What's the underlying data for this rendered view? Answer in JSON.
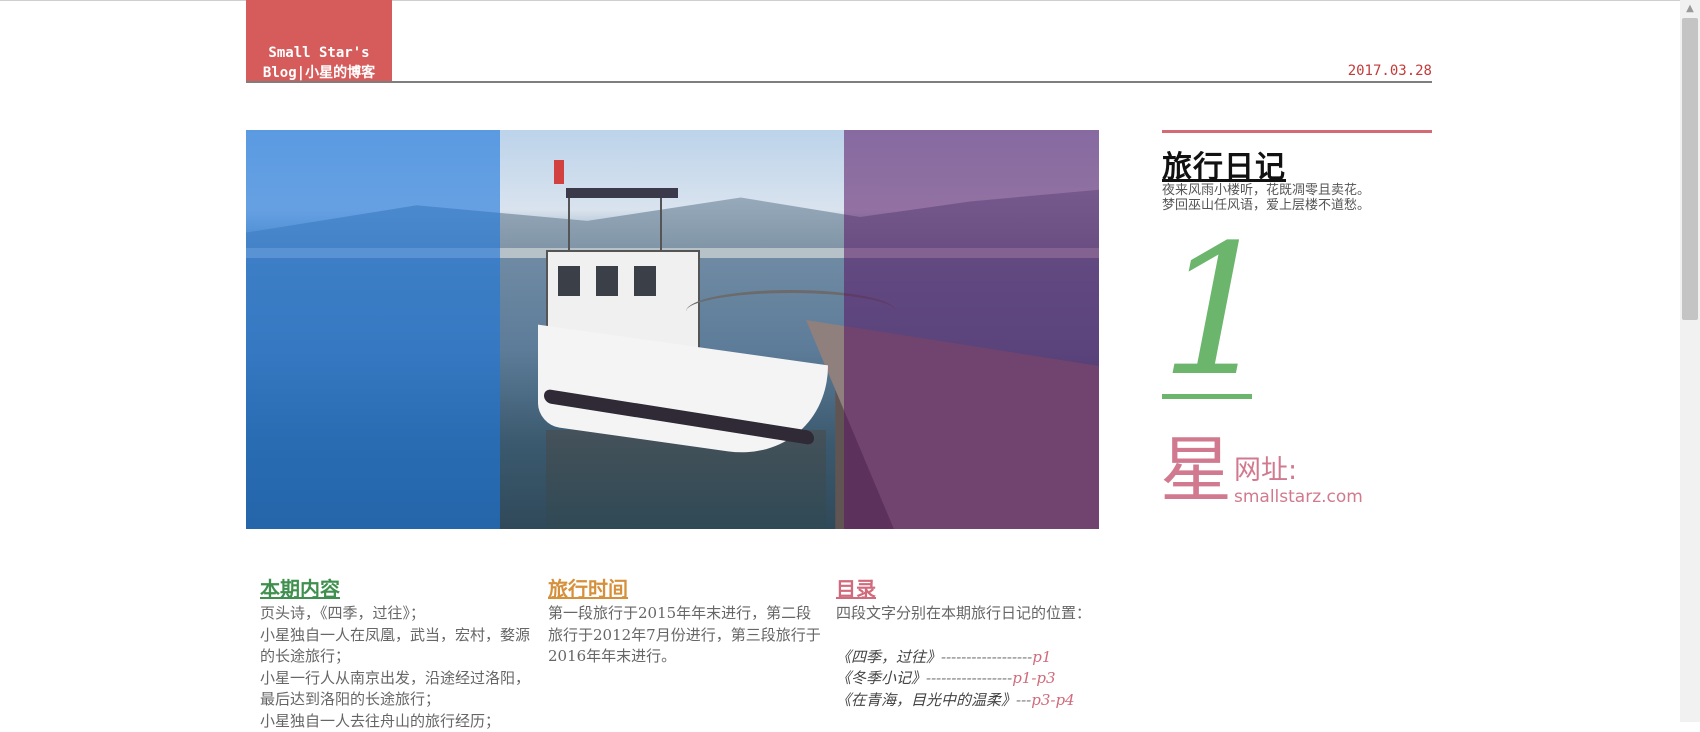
{
  "header": {
    "logo_line1": "Small Star's",
    "logo_line2": "Blog|小星的博客",
    "date": "2017.03.28"
  },
  "sidebar": {
    "title": "旅行日记",
    "poem_line1": "夜来风雨小楼听，花既凋零且卖花。",
    "poem_line2": "梦回巫山任风语，爱上层楼不道愁。",
    "issue_number": "1",
    "star_char": "星",
    "site_label": "网址:",
    "site_url": "smallstarz.com"
  },
  "sections": {
    "content": {
      "title": "本期内容",
      "lines": [
        "页头诗，《四季，过往》；",
        "小星独自一人在凤凰，武当，宏村，婺源的长途旅行；",
        "小星一行人从南京出发，沿途经过洛阳，最后达到洛阳的长途旅行；",
        "小星独自一人去往舟山的旅行经历；"
      ]
    },
    "time": {
      "title": "旅行时间",
      "text": "第一段旅行于2015年年末进行，第二段旅行于2012年7月份进行，第三段旅行于2016年年末进行。"
    },
    "toc": {
      "title": "目录",
      "intro": "四段文字分别在本期旅行日记的位置：",
      "items": [
        {
          "name": "《四季，过往》",
          "dashes": "------------------",
          "page": "p1"
        },
        {
          "name": "《冬季小记》",
          "dashes": "-----------------",
          "page": "p1-p3"
        },
        {
          "name": "《在青海，目光中的温柔》",
          "dashes": "---",
          "page": "p3-p4"
        }
      ]
    }
  },
  "colors": {
    "logo_bg": "#d65c5c",
    "date": "#c23b3b",
    "green": "#6bb56c",
    "pink": "#d17a8f",
    "orange": "#d6903c"
  }
}
